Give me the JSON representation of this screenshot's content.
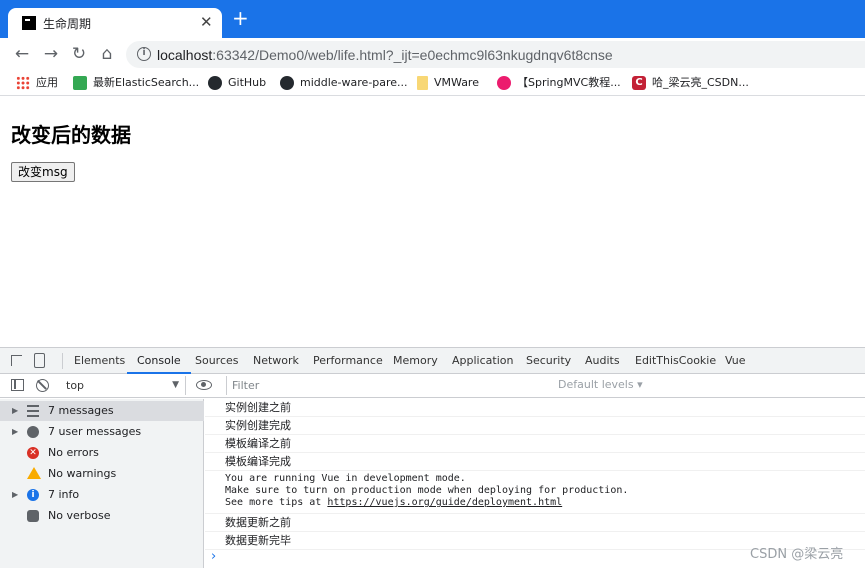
{
  "tab": {
    "title": "生命周期",
    "close": "✕",
    "new_tab": "+"
  },
  "toolbar": {
    "back": "←",
    "forward": "→",
    "reload": "↻",
    "home": "⌂",
    "url_host": "localhost",
    "url_rest": ":63342/Demo0/web/life.html?_ijt=e0echmc9l63nkugdnqv6t8cnse",
    "info_glyph": "i"
  },
  "bookmarks": [
    {
      "icon": "apps-grid-icon",
      "label": "应用"
    },
    {
      "icon": "green-bookmark-icon",
      "label": "最新ElasticSearch..."
    },
    {
      "icon": "github-icon",
      "label": "GitHub"
    },
    {
      "icon": "github-icon",
      "label": "middle-ware-pare..."
    },
    {
      "icon": "folder-icon",
      "label": "VMWare"
    },
    {
      "icon": "pink-circle-icon",
      "label": "【SpringMVC教程..."
    },
    {
      "icon": "csdn-icon",
      "label": "哈_梁云亮_CSDN...",
      "glyph": "C"
    }
  ],
  "page": {
    "heading": "改变后的数据",
    "button": "改变msg"
  },
  "devtools": {
    "tabs": [
      "Elements",
      "Console",
      "Sources",
      "Network",
      "Performance",
      "Memory",
      "Application",
      "Security",
      "Audits",
      "EditThisCookie",
      "Vue"
    ],
    "active_tab": "Console",
    "context": "top",
    "filter_placeholder": "Filter",
    "levels": "Default levels ▾",
    "sidebar": [
      {
        "label": "7 messages",
        "icon": "list-icon",
        "expandable": true,
        "selected": true
      },
      {
        "label": "7 user messages",
        "icon": "user-icon",
        "expandable": true
      },
      {
        "label": "No errors",
        "icon": "error-icon",
        "glyph": "✕"
      },
      {
        "label": "No warnings",
        "icon": "warning-icon"
      },
      {
        "label": "7 info",
        "icon": "info-icon",
        "expandable": true,
        "glyph": "i"
      },
      {
        "label": "No verbose",
        "icon": "bug-icon"
      }
    ],
    "logs": [
      "实例创建之前",
      "实例创建完成",
      "模板编译之前",
      "模板编译完成"
    ],
    "vue_notice": {
      "line1": "You are running Vue in development mode.",
      "line2": "Make sure to turn on production mode when deploying for production.",
      "line3_prefix": "See more tips at ",
      "link": "https://vuejs.org/guide/deployment.html"
    },
    "logs_after": [
      "数据更新之前",
      "数据更新完毕"
    ],
    "prompt": "›"
  },
  "watermark": "CSDN @梁云亮",
  "colors": {
    "tabstrip": "#1a73e8",
    "active_tab_underline": "#1a73e8"
  }
}
